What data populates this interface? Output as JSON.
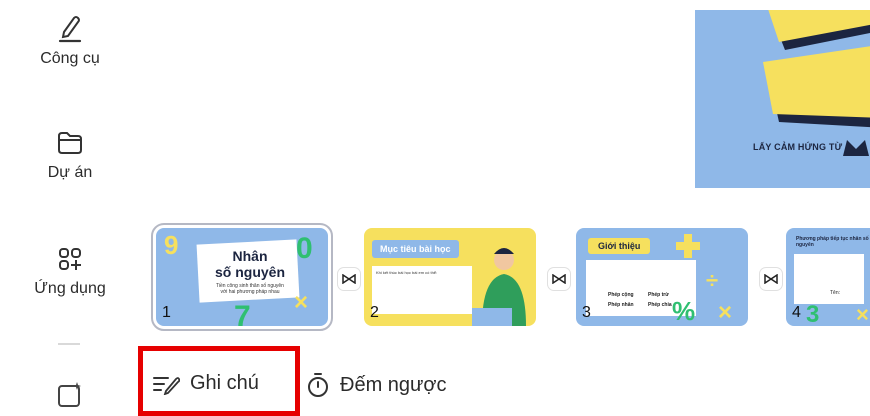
{
  "sidebar": {
    "items": [
      {
        "label": "Công cụ",
        "icon": "pen-tool-icon"
      },
      {
        "label": "Dự án",
        "icon": "folder-icon"
      },
      {
        "label": "Ứng dụng",
        "icon": "apps-grid-icon"
      },
      {
        "label": "",
        "icon": "magic-image-icon"
      }
    ]
  },
  "canvas": {
    "credit_text": "LẤY CẢM HỨNG TỪ"
  },
  "slides": [
    {
      "number": "1",
      "title_line1": "Nhân",
      "title_line2": "số nguyên",
      "subtitle": "Tiền công sinh thân số nguyên với hai phương pháp nhau"
    },
    {
      "number": "2",
      "title": "Mục tiêu bài học",
      "body": "Khi kết thúc bài học bài em có thể:"
    },
    {
      "number": "3",
      "title": "Giới thiệu",
      "ops": [
        "Phép cộng",
        "Phép trừ",
        "Phép nhân",
        "Phép chia"
      ]
    },
    {
      "number": "4",
      "title": "Phương pháp tiếp tục nhân số nguyên",
      "tag": "Tên:"
    }
  ],
  "bottom_tabs": {
    "notes_label": "Ghi chú",
    "timer_label": "Đếm ngược"
  },
  "colors": {
    "highlight": "#e60000",
    "slide_blue": "#8fb8e8",
    "slide_yellow": "#f6e05e"
  }
}
